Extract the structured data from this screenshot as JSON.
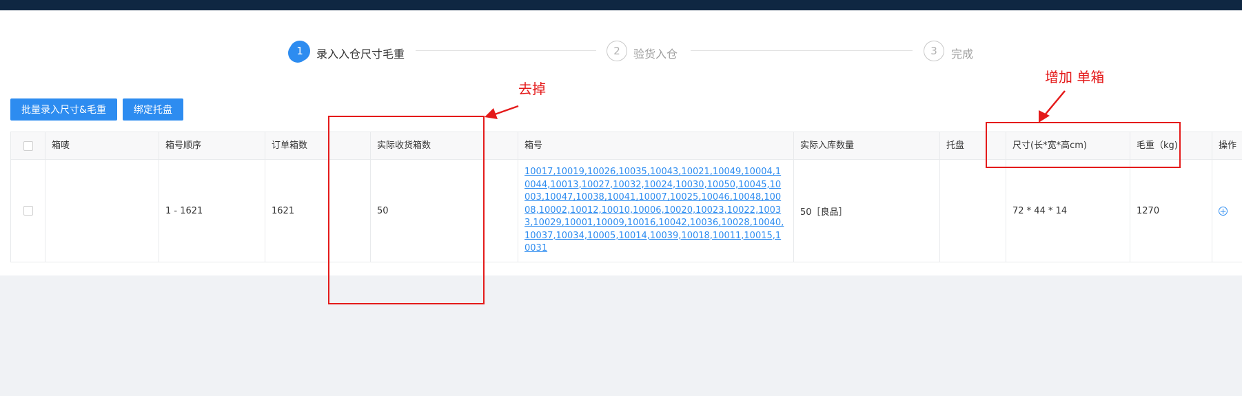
{
  "steps": [
    {
      "number": "1",
      "label": "录入入仓尺寸毛重"
    },
    {
      "number": "2",
      "label": "验货入仓"
    },
    {
      "number": "3",
      "label": "完成"
    }
  ],
  "toolbar": {
    "batch_label": "批量录入尺寸&毛重",
    "bind_pallet_label": "绑定托盘"
  },
  "table": {
    "headers": [
      "箱唛",
      "箱号顺序",
      "订单箱数",
      "实际收货箱数",
      "箱号",
      "实际入库数量",
      "托盘",
      "尺寸(长*宽*高cm)",
      "毛重（kg)",
      "操作"
    ],
    "rows": [
      {
        "mark": "",
        "box_sequence": "1 - 1621",
        "order_boxes": "1621",
        "received_boxes": "50",
        "box_numbers": "10017,10019,10026,10035,10043,10021,10049,10004,10044,10013,10027,10032,10024,10030,10050,10045,10003,10047,10038,10041,10007,10025,10046,10048,10008,10002,10012,10010,10006,10020,10023,10022,10033,10029,10001,10009,10016,10042,10036,10028,10040,10037,10034,10005,10014,10039,10018,10011,10015,10031",
        "stock_qty": "50［良品］",
        "pallet": "",
        "size": "72 * 44 * 14",
        "weight": "1270"
      }
    ]
  },
  "annotations": {
    "remove": "去掉",
    "add": "增加 单箱"
  },
  "colors": {
    "primary": "#2d8cf0",
    "topbar": "#0f2742",
    "annotation": "#e41a1a"
  }
}
